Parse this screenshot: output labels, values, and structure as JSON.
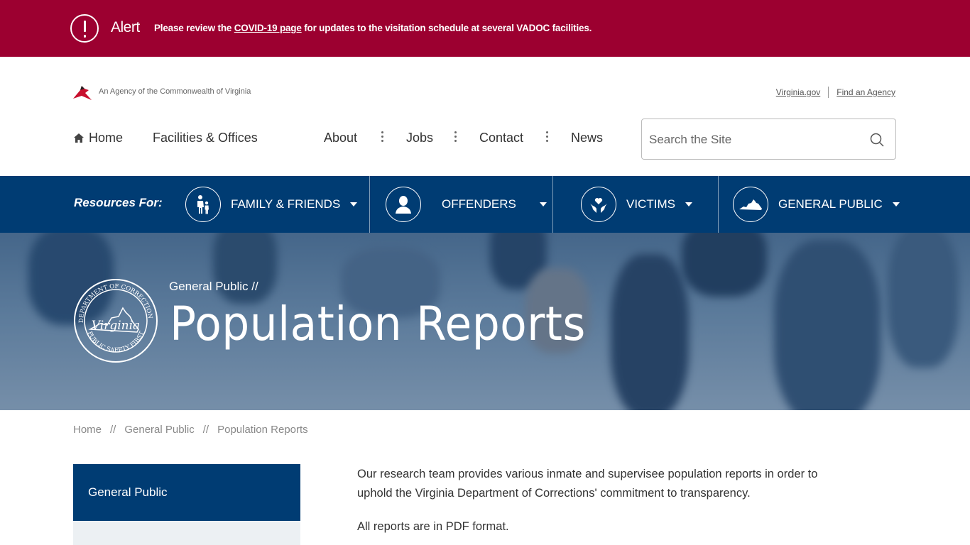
{
  "alert": {
    "title": "Alert",
    "text_before": "Please review the ",
    "link": "COVID-19 page",
    "text_after": " for updates to the visitation schedule at several VADOC facilities."
  },
  "header": {
    "agency_tagline": "An Agency of the Commonwealth of Virginia",
    "util_links": [
      "Virginia.gov",
      "Find an Agency"
    ]
  },
  "nav": {
    "home": "Home",
    "facilities": "Facilities & Offices",
    "about": "About",
    "jobs": "Jobs",
    "contact": "Contact",
    "news": "News"
  },
  "search": {
    "placeholder": "Search the Site"
  },
  "resources": {
    "label": "Resources For:",
    "items": [
      {
        "label": "FAMILY & FRIENDS",
        "icon": "family-icon"
      },
      {
        "label": "OFFENDERS",
        "icon": "person-icon"
      },
      {
        "label": "VICTIMS",
        "icon": "heart-hands-icon"
      },
      {
        "label": "GENERAL PUBLIC",
        "icon": "virginia-map-icon"
      }
    ]
  },
  "hero": {
    "crumb": "General Public  //",
    "title": "Population Reports"
  },
  "breadcrumb": {
    "items": [
      "Home",
      "General Public",
      "Population Reports"
    ],
    "separator": "//"
  },
  "sidebar": {
    "active": "General Public"
  },
  "content": {
    "paragraphs": [
      "Our research team provides various inmate and supervisee population reports in order to uphold the Virginia Department of Corrections' commitment to transparency.",
      "All reports are in PDF format."
    ]
  },
  "colors": {
    "alert_bg": "#9c0030",
    "navy": "#003c73"
  }
}
